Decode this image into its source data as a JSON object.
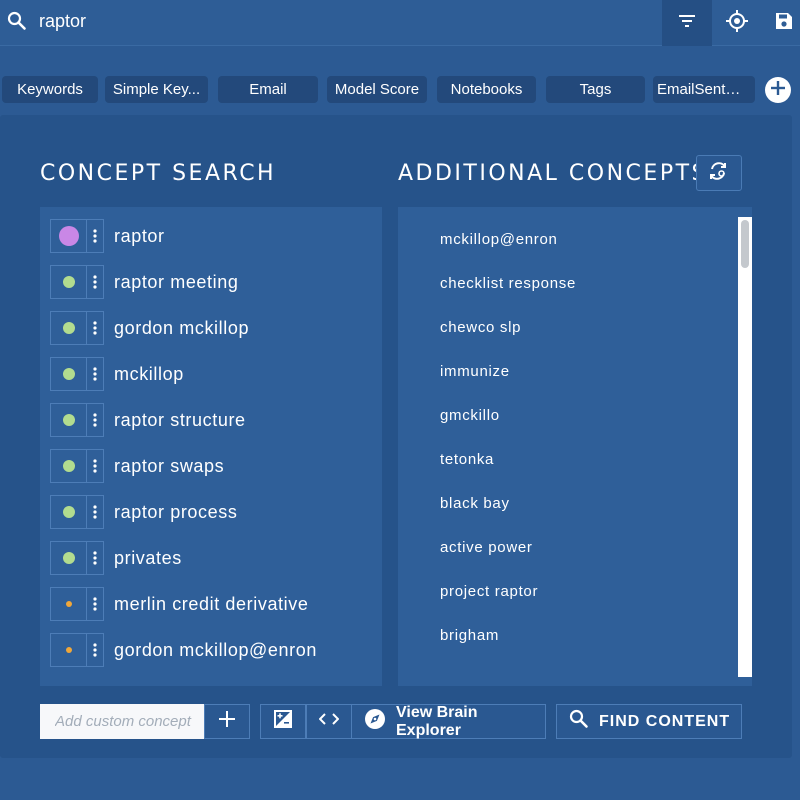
{
  "search": {
    "query": "raptor",
    "icon": "search-icon"
  },
  "toolbar": {
    "filter_icon": "filter-icon",
    "target_icon": "crosshair-icon",
    "save_icon": "save-icon"
  },
  "tabs": [
    {
      "label": "Keywords"
    },
    {
      "label": "Simple Key..."
    },
    {
      "label": "Email"
    },
    {
      "label": "Model Score"
    },
    {
      "label": "Notebooks"
    },
    {
      "label": "Tags"
    },
    {
      "label": "EmailSentDa..."
    }
  ],
  "headings": {
    "concept_search": "CONCEPT SEARCH",
    "additional_concepts": "ADDITIONAL CONCEPTS"
  },
  "concepts": [
    {
      "label": "raptor",
      "color": "#c987e6",
      "size": "large"
    },
    {
      "label": "raptor meeting",
      "color": "#b2dc8f",
      "size": "medium"
    },
    {
      "label": "gordon mckillop",
      "color": "#b2dc8f",
      "size": "medium"
    },
    {
      "label": "mckillop",
      "color": "#b2dc8f",
      "size": "medium"
    },
    {
      "label": "raptor structure",
      "color": "#b2dc8f",
      "size": "medium"
    },
    {
      "label": "raptor swaps",
      "color": "#b2dc8f",
      "size": "medium"
    },
    {
      "label": "raptor process",
      "color": "#b2dc8f",
      "size": "medium"
    },
    {
      "label": "privates",
      "color": "#b2dc8f",
      "size": "medium"
    },
    {
      "label": "merlin credit derivative",
      "color": "#f0a73a",
      "size": "small"
    },
    {
      "label": "gordon mckillop@enron",
      "color": "#f0a73a",
      "size": "small"
    }
  ],
  "additional_concepts": [
    "mckillop@enron",
    "checklist response",
    "chewco slp",
    "immunize",
    "gmckillo",
    "tetonka",
    "black bay",
    "active power",
    "project raptor",
    "brigham"
  ],
  "bottom": {
    "custom_placeholder": "Add custom concept",
    "brain_explorer_label": "View Brain Explorer",
    "find_content_label": "FIND CONTENT"
  }
}
